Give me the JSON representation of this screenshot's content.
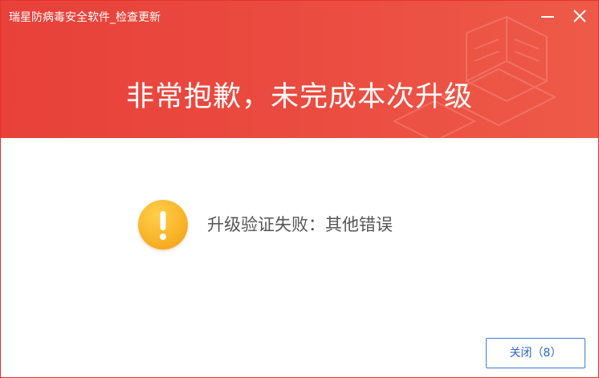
{
  "window": {
    "title": "瑞星防病毒安全软件_检查更新",
    "controls": {
      "minimize_icon": "minimize-icon",
      "close_icon": "close-icon"
    }
  },
  "header": {
    "headline": "非常抱歉，未完成本次升级",
    "background_color": "#e8413a"
  },
  "content": {
    "icon": "warning-exclamation-icon",
    "icon_color": "#f9b52a",
    "message": "升级验证失败：其他错误"
  },
  "footer": {
    "close_label": "关闭（8）",
    "button_border_color": "#3d7bd9"
  }
}
